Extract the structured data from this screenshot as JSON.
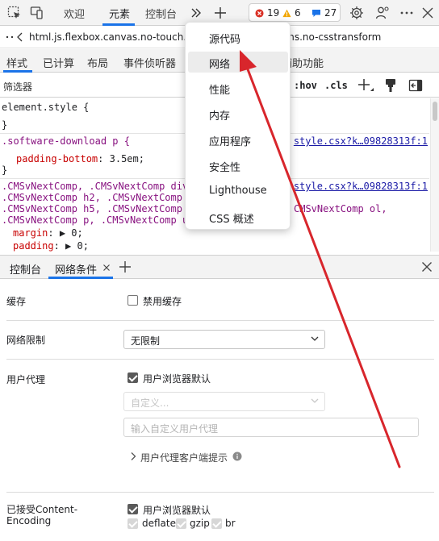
{
  "toolbar": {
    "tabs": [
      "欢迎",
      "元素",
      "控制台"
    ],
    "active_tab": "元素",
    "error_count": "19",
    "warning_count": "6",
    "issue_count": "27",
    "icons": [
      "inspect-element-icon",
      "device-toolbar-icon",
      "more-tabs-icon",
      "add-tab-icon",
      "settings-icon",
      "customize-icon",
      "more-options-icon",
      "close-icon"
    ]
  },
  "urlbar": {
    "text": "html.js.flexbox.canvas.no-touch.backg… .csstransforms.no-csstransform"
  },
  "panel_tabs": [
    "样式",
    "已计算",
    "布局",
    "事件侦听器",
    "辅助功能"
  ],
  "filter": {
    "placeholder": "筛选器",
    "hov": ":hov",
    "cls": ".cls"
  },
  "css_rules": {
    "element_style_open": "element.style {",
    "element_style_close": "}",
    "rule1_selector": ".software-download p {",
    "rule1_link": "style.csx?k…09828313f:1",
    "rule1_prop": "padding-bottom",
    "rule1_value": " 3.5em;",
    "rule1_close": "}",
    "rule2_link": "style.csx?k…09828313f:1",
    "rule2_sel1": ".CMSvNextComp, .CMSvNextComp div, .",
    "rule2_sel2": ".CMSvNextComp h2, .CMSvNextComp h3,",
    "rule2_sel3": ".CMSvNextComp h5, .CMSvNextComp h6,",
    "rule2_sel3b": "CMSvNextComp ol,",
    "rule2_sel4": ".CMSvNextComp p, .CMSvNextComp ul {",
    "rule2_prop1": "margin",
    "rule2_val1": " ▶ 0;",
    "rule2_prop2": "padding",
    "rule2_val2": " ▶ 0;"
  },
  "drawer": {
    "tabs": [
      "控制台",
      "网络条件"
    ],
    "active_tab": "网络条件"
  },
  "network_conditions": {
    "cache_label": "缓存",
    "disable_cache_label": "禁用缓存",
    "throttling_label": "网络限制",
    "throttling_value": "无限制",
    "user_agent_label": "用户代理",
    "use_browser_default_label": "用户浏览器默认",
    "custom_select_value": "自定义...",
    "custom_ua_placeholder": "输入自定义用户代理",
    "ua_client_hints_label": "用户代理客户端提示",
    "accepted_encoding_label_line1": "已接受Content-",
    "accepted_encoding_label_line2": "Encoding",
    "encoding_default_label": "用户浏览器默认",
    "encodings": [
      "deflate",
      "gzip",
      "br"
    ]
  },
  "overflow_menu": {
    "items": [
      "源代码",
      "网络",
      "性能",
      "内存",
      "应用程序",
      "安全性",
      "Lighthouse",
      "CSS 概述"
    ],
    "highlighted": "网络"
  },
  "colors": {
    "accent": "#1a73e8",
    "annotation_arrow": "#d8262c",
    "error": "#d93025",
    "warning": "#f2a600",
    "issue": "#1a73e8"
  }
}
